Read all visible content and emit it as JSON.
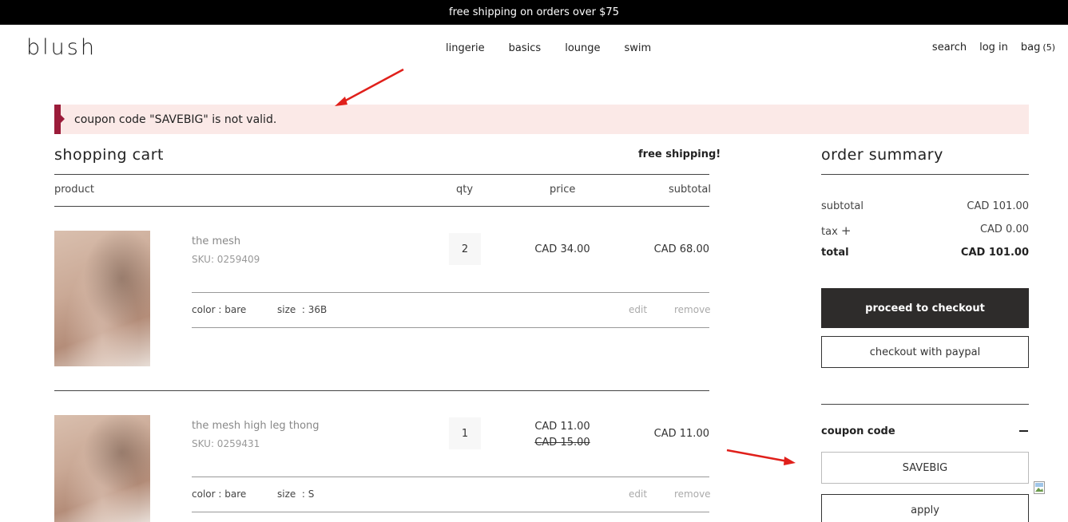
{
  "topbar": {
    "text": "free shipping on orders over $75"
  },
  "header": {
    "logo": "blush",
    "nav": [
      "lingerie",
      "basics",
      "lounge",
      "swim"
    ],
    "search": "search",
    "login": "log in",
    "bag": "bag",
    "bag_count": "(5)"
  },
  "alert": {
    "message": "coupon code \"SAVEBIG\" is not valid."
  },
  "cart": {
    "title": "shopping cart",
    "free_shipping": "free shipping!",
    "columns": {
      "product": "product",
      "qty": "qty",
      "price": "price",
      "subtotal": "subtotal"
    },
    "items": [
      {
        "name": "the mesh",
        "sku": "SKU: 0259409",
        "qty": "2",
        "price": "CAD 34.00",
        "original_price": "",
        "subtotal": "CAD 68.00",
        "color": "color : bare",
        "size": "size  : 36B",
        "edit": "edit",
        "remove": "remove"
      },
      {
        "name": "the mesh high leg thong",
        "sku": "SKU: 0259431",
        "qty": "1",
        "price": "CAD 11.00",
        "original_price": "CAD 15.00",
        "subtotal": "CAD 11.00",
        "color": "color : bare",
        "size": "size  : S",
        "edit": "edit",
        "remove": "remove"
      }
    ]
  },
  "summary": {
    "title": "order summary",
    "subtotal_label": "subtotal",
    "subtotal_value": "CAD 101.00",
    "tax_label": "tax",
    "tax_value": "CAD 0.00",
    "total_label": "total",
    "total_value": "CAD 101.00",
    "checkout": "proceed to checkout",
    "paypal": "checkout with paypal",
    "coupon_label": "coupon code",
    "coupon_value": "SAVEBIG",
    "apply": "apply"
  },
  "colors": {
    "alert_bg": "#fbe9e7",
    "alert_bar": "#9b1c3a",
    "checkout_bg": "#2e2c2b",
    "annotation_arrow": "#e0201b"
  }
}
